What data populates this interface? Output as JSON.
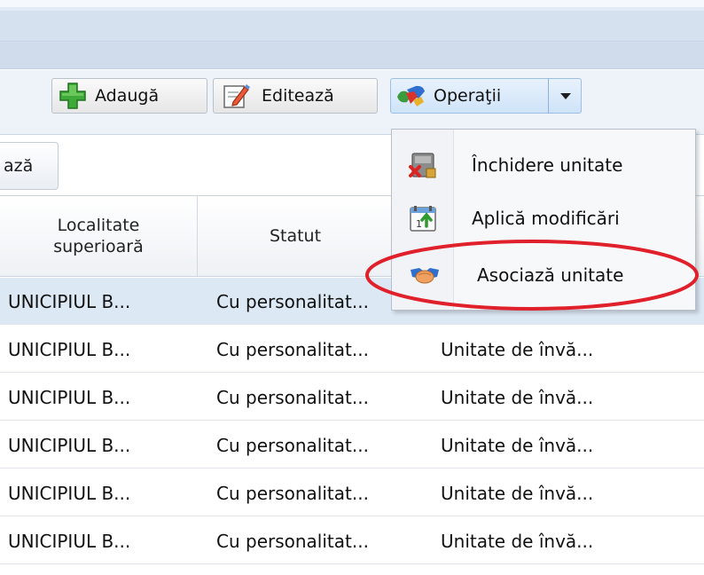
{
  "toolbar": {
    "add_label": "Adaugă",
    "edit_label": "Editează",
    "ops_label": "Operaţii"
  },
  "subtab": {
    "label": "ază"
  },
  "grid": {
    "columns": [
      "Localitate superioară",
      "Statut"
    ],
    "rows": [
      {
        "localitate": "UNICIPIUL B...",
        "statut": "Cu personalitat...",
        "tip": "",
        "selected": true
      },
      {
        "localitate": "UNICIPIUL B...",
        "statut": "Cu personalitat...",
        "tip": "Unitate de învă..."
      },
      {
        "localitate": "UNICIPIUL B...",
        "statut": "Cu personalitat...",
        "tip": "Unitate de învă..."
      },
      {
        "localitate": "UNICIPIUL B...",
        "statut": "Cu personalitat...",
        "tip": "Unitate de învă..."
      },
      {
        "localitate": "UNICIPIUL B...",
        "statut": "Cu personalitat...",
        "tip": "Unitate de învă..."
      },
      {
        "localitate": "UNICIPIUL B...",
        "statut": "Cu personalitat...",
        "tip": "Unitate de învă..."
      }
    ]
  },
  "menu": {
    "items": [
      {
        "label": "Închidere unitate",
        "icon": "close-unit-icon"
      },
      {
        "label": "Aplică modificări",
        "icon": "apply-changes-icon"
      },
      {
        "label": "Asociază unitate",
        "icon": "handshake-icon",
        "highlighted": true
      }
    ]
  },
  "colors": {
    "highlight_ring": "#e0202a",
    "selected_row": "#dde8f5",
    "ops_button": "#d6e8fb"
  }
}
